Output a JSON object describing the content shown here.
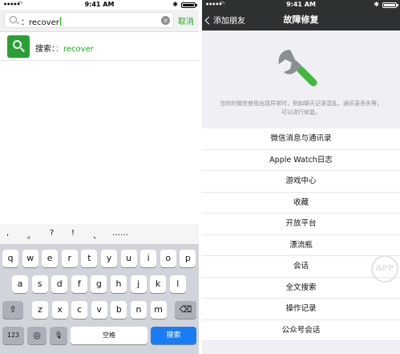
{
  "left": {
    "status": {
      "carrier": "•••••",
      "time": "9:41 AM"
    },
    "search": {
      "value": "：recover",
      "cancel_label": "取消"
    },
    "result": {
      "prefix": "搜索：",
      "keyword": "：recover"
    },
    "keyboard": {
      "suggestions": [
        ",",
        "。",
        "?",
        "!",
        "、",
        "……"
      ],
      "row1": [
        "q",
        "w",
        "e",
        "r",
        "t",
        "y",
        "u",
        "i",
        "o",
        "p"
      ],
      "row2": [
        "a",
        "s",
        "d",
        "f",
        "g",
        "h",
        "j",
        "k",
        "l"
      ],
      "row3": [
        "z",
        "x",
        "c",
        "v",
        "b",
        "n",
        "m"
      ],
      "num_key": "123",
      "space_key": "空格",
      "search_key": "搜索"
    }
  },
  "right": {
    "status": {
      "carrier": "•••••",
      "time": "9:41 AM"
    },
    "nav": {
      "back_label": "添加朋友",
      "title": "故障修复"
    },
    "description": "当你的微信使用出现异常时，例如聊天记录混乱、通讯录丢失等，可以进行修复。",
    "menu_items": [
      "微信消息与通讯录",
      "Apple Watch日志",
      "游戏中心",
      "收藏",
      "开放平台",
      "漂流瓶",
      "会话",
      "全文搜索",
      "操作记录",
      "公众号会话"
    ],
    "watermark": "APP"
  },
  "colors": {
    "wechat_green": "#1aad19",
    "nav_dark": "#2e3132",
    "key_blue": "#1a7cf4"
  }
}
